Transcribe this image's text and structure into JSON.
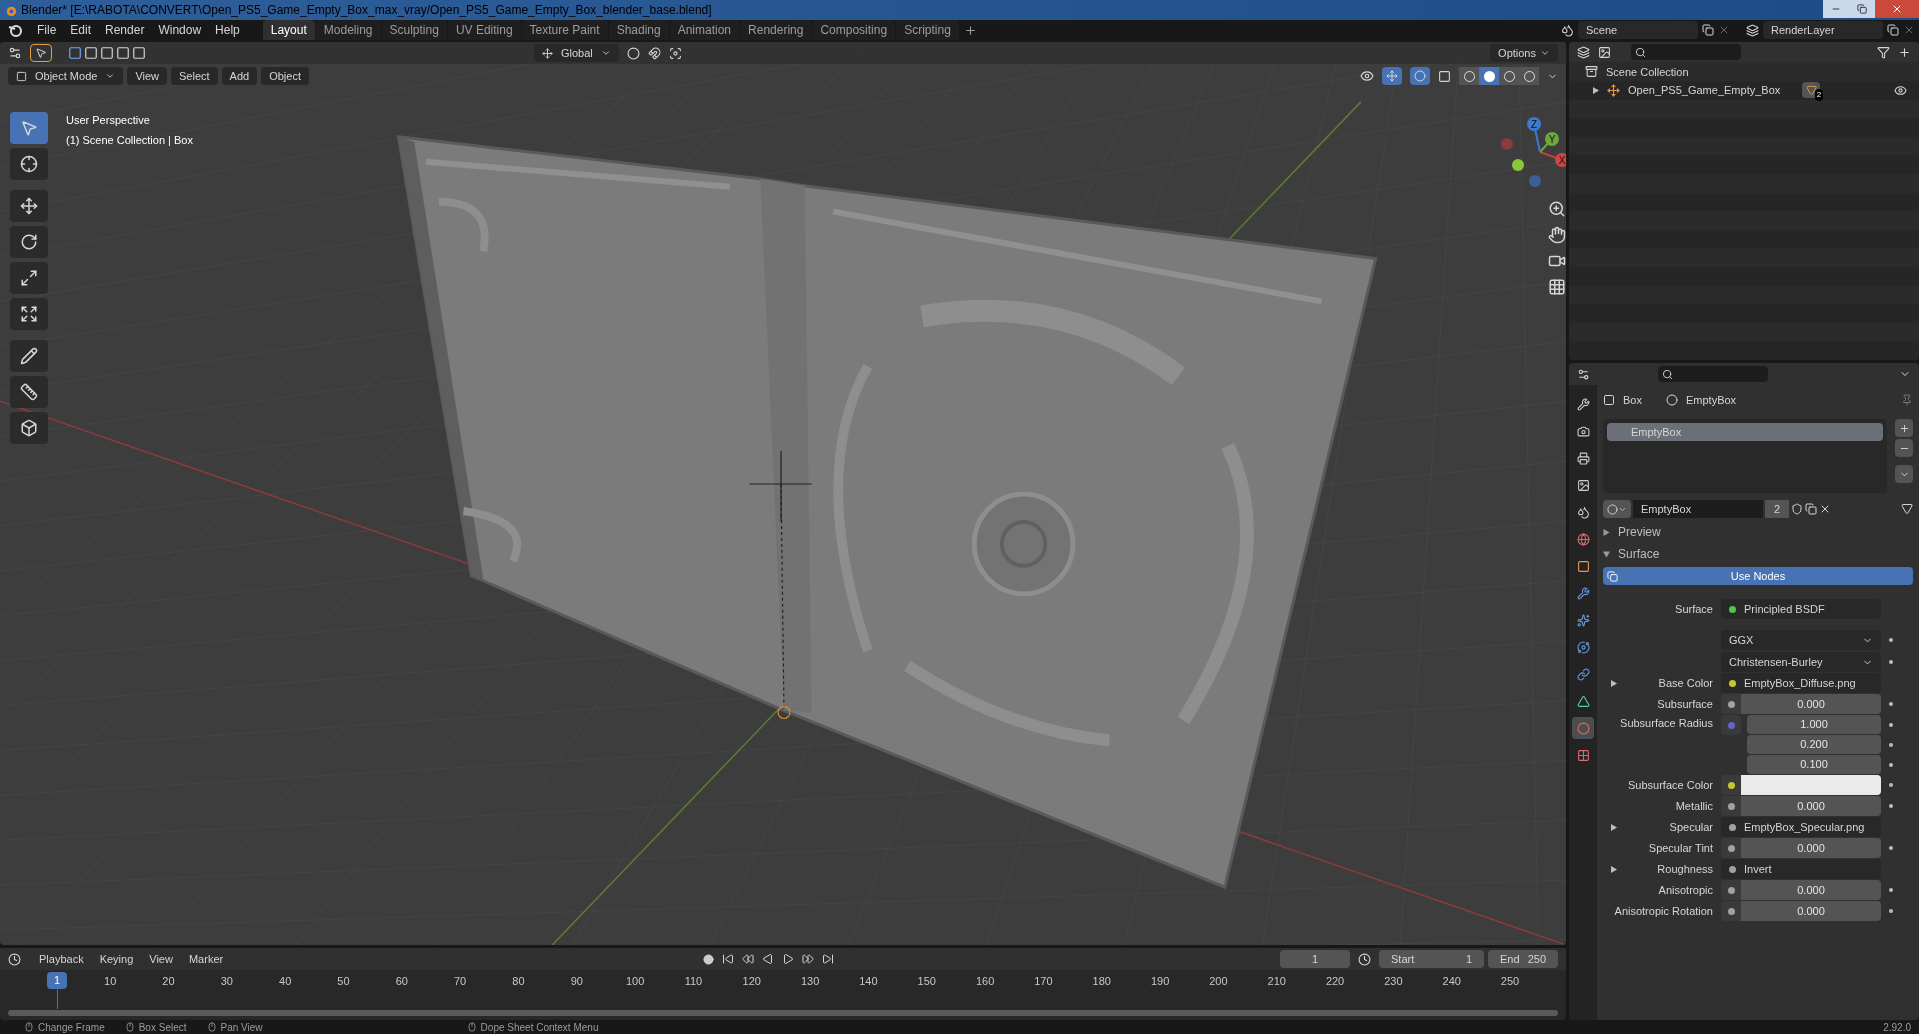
{
  "window": {
    "title": "Blender* [E:\\RABOTA\\CONVERT\\Open_PS5_Game_Empty_Box_max_vray/Open_PS5_Game_Empty_Box_blender_base.blend]"
  },
  "menus": [
    "File",
    "Edit",
    "Render",
    "Window",
    "Help"
  ],
  "workspaces": [
    {
      "label": "Layout",
      "selected": true
    },
    {
      "label": "Modeling",
      "selected": false
    },
    {
      "label": "Sculpting",
      "selected": false
    },
    {
      "label": "UV Editing",
      "selected": false
    },
    {
      "label": "Texture Paint",
      "selected": false
    },
    {
      "label": "Shading",
      "selected": false
    },
    {
      "label": "Animation",
      "selected": false
    },
    {
      "label": "Rendering",
      "selected": false
    },
    {
      "label": "Compositing",
      "selected": false
    },
    {
      "label": "Scripting",
      "selected": false
    }
  ],
  "scene": {
    "name": "Scene",
    "view_layer": "RenderLayer"
  },
  "tool_header": {
    "transform": "Global",
    "options": "Options"
  },
  "viewport_header": {
    "mode": "Object Mode",
    "menus": [
      "View",
      "Select",
      "Add",
      "Object"
    ],
    "shading": [
      {
        "selected": false
      },
      {
        "selected": true
      },
      {
        "selected": false
      },
      {
        "selected": false
      }
    ]
  },
  "viewport": {
    "overlay_text": [
      "User Perspective",
      "(1) Scene Collection | Box"
    ],
    "gizmo_axes": [
      "X",
      "Y",
      "Z"
    ]
  },
  "tools": [
    {
      "kind": "select",
      "selected": true
    },
    {
      "kind": "cursor",
      "selected": false
    },
    {
      "kind": "move",
      "selected": false
    },
    {
      "kind": "rotate",
      "selected": false
    },
    {
      "kind": "scale",
      "selected": false
    },
    {
      "kind": "transform",
      "selected": false
    },
    {
      "kind": "annotate",
      "selected": false
    },
    {
      "kind": "measure",
      "selected": false
    },
    {
      "kind": "add_cube",
      "selected": false
    }
  ],
  "outliner": {
    "root": "Scene Collection",
    "items": [
      {
        "label": "Open_PS5_Game_Empty_Box",
        "expanded": false,
        "badge": "2"
      }
    ]
  },
  "properties": {
    "tabs": [
      {
        "kind": "tool",
        "selected": false
      },
      {
        "kind": "render",
        "selected": false
      },
      {
        "kind": "output",
        "selected": false
      },
      {
        "kind": "view_layer",
        "selected": false
      },
      {
        "kind": "scene",
        "selected": false
      },
      {
        "kind": "world",
        "selected": false
      },
      {
        "kind": "object",
        "selected": false
      },
      {
        "kind": "modifier",
        "selected": false
      },
      {
        "kind": "particles",
        "selected": false
      },
      {
        "kind": "physics",
        "selected": false
      },
      {
        "kind": "constraints",
        "selected": false
      },
      {
        "kind": "data",
        "selected": false
      },
      {
        "kind": "material",
        "selected": true
      },
      {
        "kind": "texture",
        "selected": false
      }
    ],
    "breadcrumb": [
      "Box",
      "EmptyBox"
    ],
    "slots": [
      {
        "label": "EmptyBox",
        "selected": true
      }
    ],
    "material": {
      "name": "EmptyBox",
      "users": "2"
    },
    "panels": [
      {
        "label": "Preview",
        "expanded": false
      },
      {
        "label": "Surface",
        "expanded": true
      }
    ],
    "use_nodes": "Use Nodes",
    "rows": [
      {
        "kind": "link",
        "label": "Surface",
        "value": "Principled BSDF",
        "color": "#4fc64f"
      },
      {
        "kind": "dropdown",
        "value": "GGX"
      },
      {
        "kind": "dropdown",
        "value": "Christensen-Burley"
      },
      {
        "kind": "link",
        "label": "Base Color",
        "value": "EmptyBox_Diffuse.png",
        "color": "#c7c72e",
        "expandable": true
      },
      {
        "kind": "value",
        "label": "Subsurface",
        "value": "0.000",
        "color": "#a1a1a1"
      },
      {
        "kind": "vector",
        "label": "Subsurface Radius",
        "values": [
          "1.000",
          "0.200",
          "0.100"
        ],
        "color": "#6363c7"
      },
      {
        "kind": "color",
        "label": "Subsurface Color",
        "swatch": {
          "color": "#eaeaea"
        },
        "color": "#c7c72e"
      },
      {
        "kind": "value",
        "label": "Metallic",
        "value": "0.000",
        "color": "#a1a1a1"
      },
      {
        "kind": "link",
        "label": "Specular",
        "value": "EmptyBox_Specular.png",
        "color": "#a1a1a1",
        "expandable": true
      },
      {
        "kind": "value",
        "label": "Specular Tint",
        "value": "0.000",
        "color": "#a1a1a1"
      },
      {
        "kind": "link",
        "label": "Roughness",
        "value": "Invert",
        "color": "#a1a1a1",
        "expandable": true
      },
      {
        "kind": "value",
        "label": "Anisotropic",
        "value": "0.000",
        "color": "#a1a1a1"
      },
      {
        "kind": "value",
        "label": "Anisotropic Rotation",
        "value": "0.000",
        "color": "#a1a1a1"
      }
    ]
  },
  "timeline": {
    "menus": [
      "Playback",
      "Keying",
      "View",
      "Marker"
    ],
    "current_frame": "1",
    "start_label": "Start",
    "start": "1",
    "end_label": "End",
    "end": "250",
    "marker": "1",
    "ticks": [
      "10",
      "20",
      "30",
      "40",
      "50",
      "60",
      "70",
      "80",
      "90",
      "100",
      "110",
      "120",
      "130",
      "140",
      "150",
      "160",
      "170",
      "180",
      "190",
      "200",
      "210",
      "220",
      "230",
      "240",
      "250"
    ]
  },
  "status_bar": {
    "hints": [
      "Change Frame",
      "Box Select",
      "Pan View",
      "Dope Sheet Context Menu"
    ],
    "version": "2.92.0"
  }
}
